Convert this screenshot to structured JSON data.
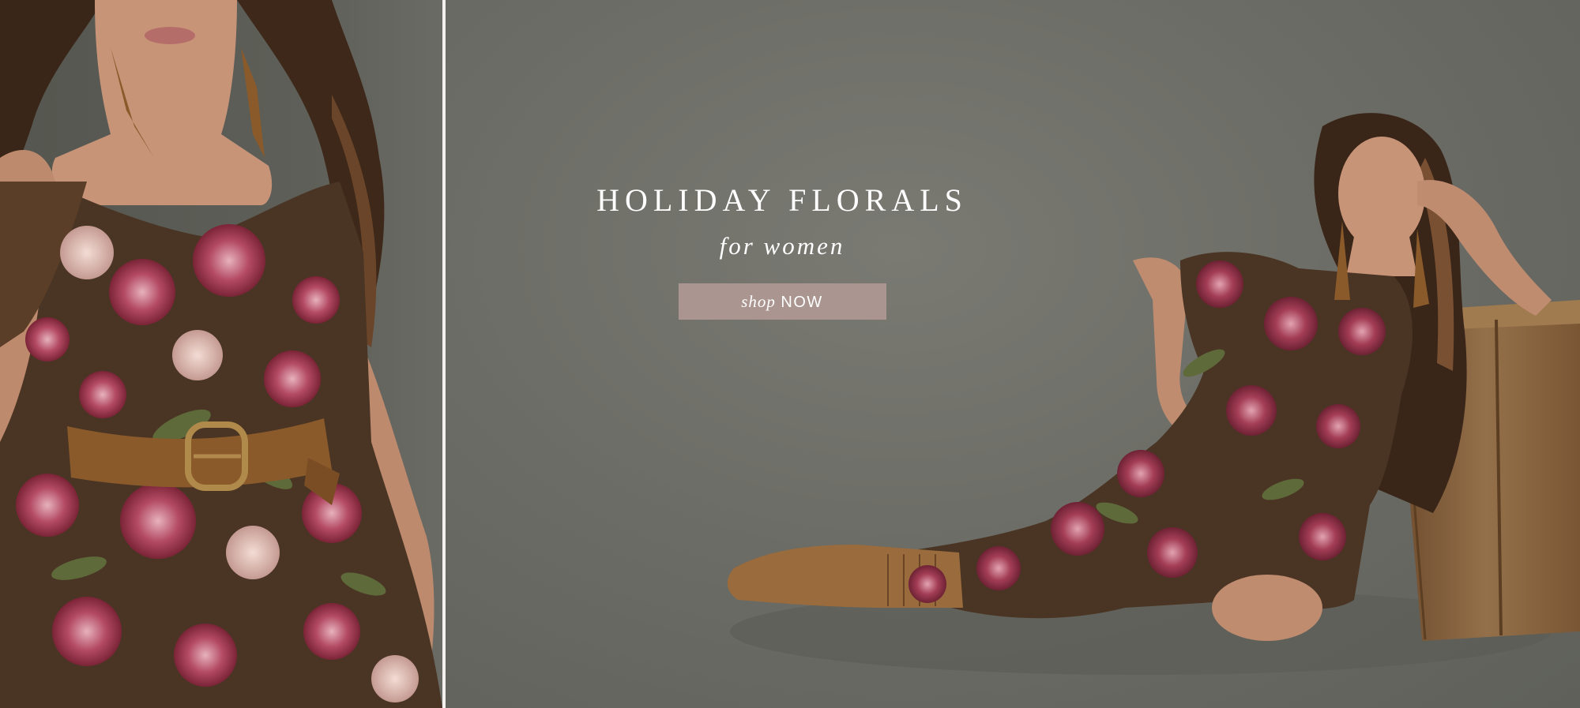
{
  "hero": {
    "headline": "HOLIDAY FLORALS",
    "subheadline": "for women",
    "cta": {
      "shop_text": "shop",
      "now_text": "NOW"
    }
  },
  "colors": {
    "background_gray": "#6a6a64",
    "button_fill": "#ab9590",
    "text": "#ffffff",
    "dress_brown": "#4a3524",
    "flower_pink": "#a33d55",
    "belt_tan": "#8b5a2b",
    "crate_wood": "#8a6440"
  },
  "images": [
    {
      "name": "model-closeup-photo",
      "description_icon": "floral-dress-closeup"
    },
    {
      "name": "model-reclining-photo",
      "description_icon": "floral-dress-reclining"
    }
  ]
}
